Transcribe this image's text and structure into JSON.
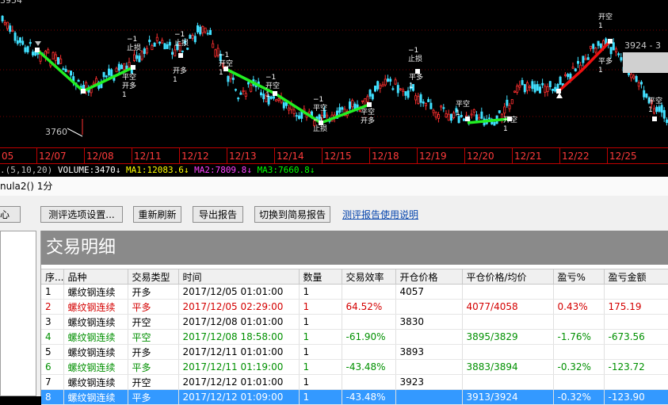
{
  "chart": {
    "top_price_label": "3954",
    "low_price_label": "3760",
    "right_price_label": "3924 - 3",
    "signals": [
      {
        "lines": [
          "−1",
          "止损"
        ]
      },
      {
        "lines": [
          "平空",
          "开多",
          "1"
        ]
      },
      {
        "lines": [
          "−1",
          "止损"
        ]
      },
      {
        "lines": [
          "开多",
          "1"
        ]
      },
      {
        "lines": [
          "−1",
          "开空",
          "1"
        ]
      },
      {
        "lines": [
          "−1",
          "开空",
          "1"
        ]
      },
      {
        "lines": [
          "−1",
          "平空"
        ]
      },
      {
        "lines": [
          "−1",
          "止损"
        ]
      },
      {
        "lines": [
          "平空",
          "开多"
        ]
      },
      {
        "lines": [
          "−1",
          "止损"
        ]
      },
      {
        "lines": [
          "平多",
          "1"
        ]
      },
      {
        "lines": [
          "平空",
          "1"
        ]
      },
      {
        "lines": [
          "开空",
          "1"
        ]
      },
      {
        "lines": [
          "开空",
          "1"
        ]
      },
      {
        "lines": [
          "平多",
          "1"
        ]
      },
      {
        "lines": [
          "平空",
          "1"
        ]
      }
    ]
  },
  "dates": [
    "05",
    "12/07",
    "12/08",
    "12/11",
    "12/12",
    "12/13",
    "12/14",
    "12/15",
    "12/18",
    "12/19",
    "12/20",
    "12/21",
    "12/22",
    "12/25"
  ],
  "indicator": {
    "params": ".(5,10,20)",
    "volume": "VOLUME:3470",
    "ma1": "MA1:12083.6",
    "ma2": "MA2:7809.8",
    "ma3": "MA3:7660.8",
    "arrow": "↓",
    "colors": {
      "params": "#c0c0c0",
      "volume": "#ffffff",
      "ma1": "#ffff00",
      "ma2": "#ff40ff",
      "ma3": "#00ff00"
    }
  },
  "window_title": "nula2() 1分",
  "toolbar": {
    "left_stub": "心",
    "settings": "测评选项设置...",
    "refresh": "重新刷新",
    "export": "导出报告",
    "simple": "切换到简易报告",
    "help_link": "测评报告使用说明"
  },
  "report": {
    "title": "交易明细",
    "columns": [
      "序...",
      "品种",
      "交易类型",
      "时间",
      "数量",
      "交易效率",
      "开仓价格",
      "平仓价格/均价",
      "盈亏%",
      "盈亏金额"
    ],
    "rows": [
      {
        "color": "black",
        "cells": [
          "1",
          "螺纹钢连续",
          "开多",
          "2017/12/05 01:01:00",
          "1",
          "",
          "4057",
          "",
          "",
          ""
        ]
      },
      {
        "color": "red",
        "cells": [
          "2",
          "螺纹钢连续",
          "平多",
          "2017/12/05 02:29:00",
          "1",
          "64.52%",
          "",
          "4077/4058",
          "0.43%",
          "175.19"
        ]
      },
      {
        "color": "black",
        "cells": [
          "3",
          "螺纹钢连续",
          "开空",
          "2017/12/08 01:01:00",
          "1",
          "",
          "3830",
          "",
          "",
          ""
        ]
      },
      {
        "color": "green",
        "cells": [
          "4",
          "螺纹钢连续",
          "平空",
          "2017/12/08 18:58:00",
          "1",
          "-61.90%",
          "",
          "3895/3829",
          "-1.76%",
          "-673.56"
        ]
      },
      {
        "color": "black",
        "cells": [
          "5",
          "螺纹钢连续",
          "开多",
          "2017/12/11 01:01:00",
          "1",
          "",
          "3893",
          "",
          "",
          ""
        ]
      },
      {
        "color": "green",
        "cells": [
          "6",
          "螺纹钢连续",
          "平多",
          "2017/12/11 01:19:00",
          "1",
          "-43.48%",
          "",
          "3883/3894",
          "-0.32%",
          "-123.72"
        ]
      },
      {
        "color": "black",
        "cells": [
          "7",
          "螺纹钢连续",
          "开空",
          "2017/12/12 01:01:00",
          "1",
          "",
          "3923",
          "",
          "",
          ""
        ]
      },
      {
        "color": "sel",
        "cells": [
          "8",
          "螺纹钢连续",
          "平多",
          "2017/12/12 01:09:00",
          "1",
          "-43.48%",
          "",
          "3913/3924",
          "-0.32%",
          "-123.90"
        ]
      }
    ]
  }
}
